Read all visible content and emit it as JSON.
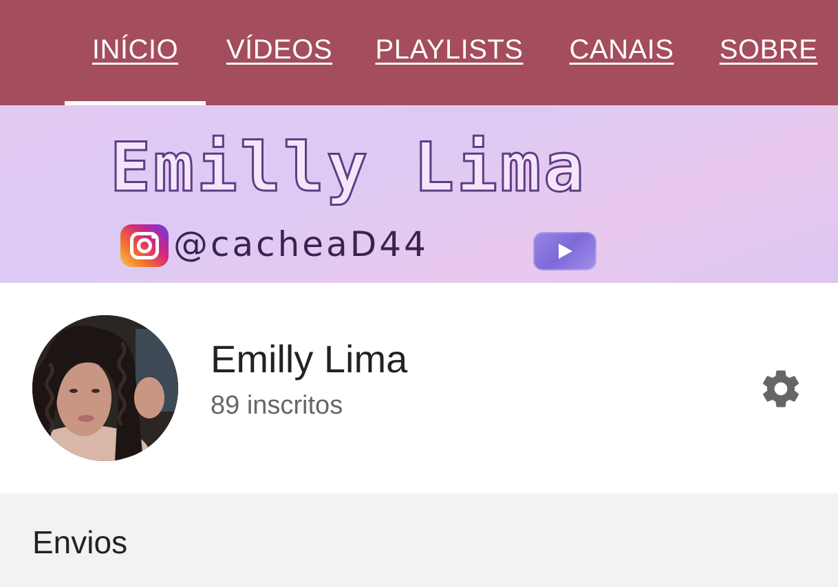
{
  "tabs": [
    {
      "label": "INÍCIO",
      "active": true
    },
    {
      "label": "VÍDEOS",
      "active": false
    },
    {
      "label": "PLAYLISTS",
      "active": false
    },
    {
      "label": "CANAIS",
      "active": false
    },
    {
      "label": "SOBRE",
      "active": false
    }
  ],
  "banner": {
    "title": "Emilly Lima",
    "handle": "@cacheaD44",
    "icons": [
      "instagram-icon",
      "youtube-play-icon"
    ]
  },
  "channel": {
    "name": "Emilly Lima",
    "subscribers": "89 inscritos",
    "settings_icon": "gear-icon"
  },
  "uploads": {
    "title": "Envios"
  },
  "colors": {
    "tab_bar": "#a44d5c",
    "banner_bg": "#dccaf4",
    "uploads_bg": "#f2f2f2",
    "text_primary": "#222222",
    "text_secondary": "#666666",
    "gear": "#666666"
  }
}
